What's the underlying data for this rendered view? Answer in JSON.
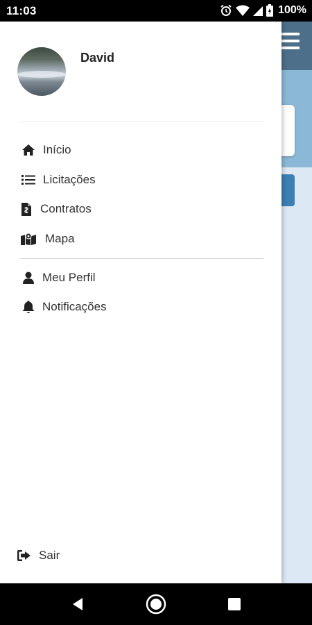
{
  "status_bar": {
    "time": "11:03",
    "battery_percent": "100%",
    "icons": [
      "alarm-icon",
      "wifi-icon",
      "signal-icon",
      "battery-icon"
    ]
  },
  "user": {
    "name": "David"
  },
  "menu": {
    "primary": [
      {
        "label": "Início",
        "icon": "home-icon"
      },
      {
        "label": "Licitações",
        "icon": "list-icon"
      },
      {
        "label": "Contratos",
        "icon": "file-contract-icon"
      },
      {
        "label": "Mapa",
        "icon": "map-icon"
      }
    ],
    "secondary": [
      {
        "label": "Meu Perfil",
        "icon": "user-icon"
      },
      {
        "label": "Notificações",
        "icon": "bell-icon"
      }
    ],
    "logout": {
      "label": "Sair",
      "icon": "sign-out-icon"
    }
  },
  "colors": {
    "drawer_bg": "#ffffff",
    "text": "#333333",
    "background_header": "#4d6f8a",
    "background_hero": "#8cb8d8",
    "background_accent_button": "#3b7fb3"
  },
  "nav_bar": {
    "buttons": [
      "back-icon",
      "home-circle-icon",
      "recents-icon"
    ]
  }
}
